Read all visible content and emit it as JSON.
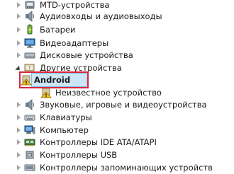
{
  "tree": {
    "items": [
      {
        "label": "MTD-устройства",
        "icon": "mtd-device-icon",
        "expanded": false
      },
      {
        "label": "Аудиовходы и аудиовыходы",
        "icon": "audio-io-icon",
        "expanded": false
      },
      {
        "label": "Батареи",
        "icon": "battery-icon",
        "expanded": false
      },
      {
        "label": "Видеоадаптеры",
        "icon": "display-adapter-icon",
        "expanded": false
      },
      {
        "label": "Дисковые устройства",
        "icon": "disk-drive-icon",
        "expanded": false
      },
      {
        "label": "Другие устройства",
        "icon": "other-devices-icon",
        "expanded": true
      },
      {
        "label": "Android",
        "icon": "unknown-device-warning-icon",
        "child": true,
        "selected": true
      },
      {
        "label": "Неизвестное устройство",
        "icon": "unknown-device-warning-icon",
        "child": true
      },
      {
        "label": "Звуковые, игровые и видеоустройства",
        "icon": "sound-video-game-icon",
        "expanded": false
      },
      {
        "label": "Клавиатуры",
        "icon": "keyboard-icon",
        "expanded": false
      },
      {
        "label": "Компьютер",
        "icon": "computer-icon",
        "expanded": false
      },
      {
        "label": "Контроллеры IDE ATA/ATAPI",
        "icon": "ide-controller-icon",
        "expanded": false
      },
      {
        "label": "Контроллеры USB",
        "icon": "usb-controller-icon",
        "expanded": false
      },
      {
        "label": "Контроллеры запоминающих устройств",
        "icon": "storage-controller-icon",
        "expanded": false
      }
    ]
  },
  "colors": {
    "highlight_border": "#d9243a",
    "selection_fill": "#cde6f7",
    "selection_border": "#7fb8e4"
  }
}
